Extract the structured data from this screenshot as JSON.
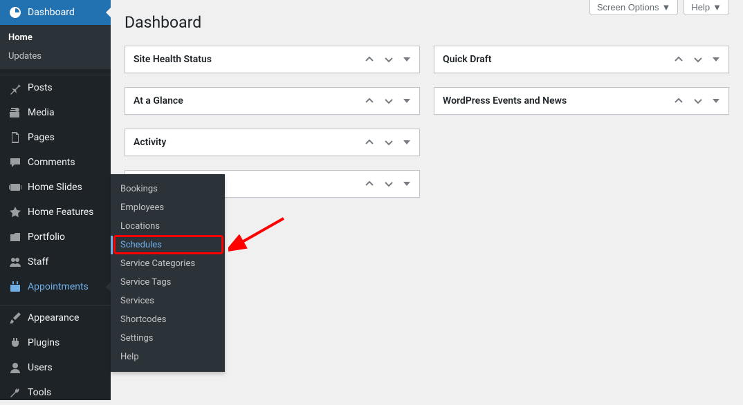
{
  "sidebar": {
    "items": [
      {
        "label": "Dashboard"
      },
      {
        "label": "Posts"
      },
      {
        "label": "Media"
      },
      {
        "label": "Pages"
      },
      {
        "label": "Comments"
      },
      {
        "label": "Home Slides"
      },
      {
        "label": "Home Features"
      },
      {
        "label": "Portfolio"
      },
      {
        "label": "Staff"
      },
      {
        "label": "Appointments"
      },
      {
        "label": "Appearance"
      },
      {
        "label": "Plugins"
      },
      {
        "label": "Users"
      },
      {
        "label": "Tools"
      }
    ],
    "dashboard_sub": [
      {
        "label": "Home"
      },
      {
        "label": "Updates"
      }
    ]
  },
  "flyout": {
    "items": [
      {
        "label": "Bookings"
      },
      {
        "label": "Employees"
      },
      {
        "label": "Locations"
      },
      {
        "label": "Schedules"
      },
      {
        "label": "Service Categories"
      },
      {
        "label": "Service Tags"
      },
      {
        "label": "Services"
      },
      {
        "label": "Shortcodes"
      },
      {
        "label": "Settings"
      },
      {
        "label": "Help"
      }
    ]
  },
  "header": {
    "title": "Dashboard",
    "screen_options": "Screen Options",
    "help": "Help"
  },
  "postboxes": {
    "col1": [
      {
        "title": "Site Health Status"
      },
      {
        "title": "At a Glance"
      },
      {
        "title": "Activity"
      },
      {
        "title": ""
      }
    ],
    "col2": [
      {
        "title": "Quick Draft"
      },
      {
        "title": "WordPress Events and News"
      }
    ]
  }
}
